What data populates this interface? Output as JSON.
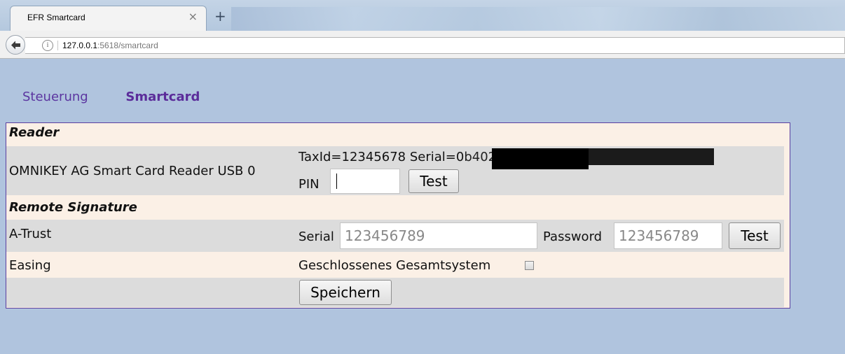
{
  "browser": {
    "tab_title": "EFR Smartcard",
    "tab_close_glyph": "×",
    "new_tab_glyph": "+",
    "url_host": "127.0.0.1",
    "url_rest": ":5618/smartcard",
    "info_glyph": "i"
  },
  "nav": {
    "items": [
      "Steuerung",
      "Smartcard"
    ],
    "active": "Smartcard"
  },
  "reader": {
    "section_title": "Reader",
    "device_name": "OMNIKEY AG Smart Card Reader USB 0",
    "card_info": "TaxId=12345678 Serial=0",
    "card_info_tail": "b4021c572eb3557",
    "pin_label": "PIN",
    "pin_value": "",
    "test_button": "Test"
  },
  "remote": {
    "section_title": "Remote Signature",
    "provider": "A-Trust",
    "serial_label": "Serial",
    "serial_placeholder": "123456789",
    "password_label": "Password",
    "password_placeholder": "123456789",
    "test_button": "Test"
  },
  "easing": {
    "label": "Easing",
    "checkbox_label": "Geschlossenes Gesamtsystem",
    "checked": false
  },
  "save_button": "Speichern"
}
